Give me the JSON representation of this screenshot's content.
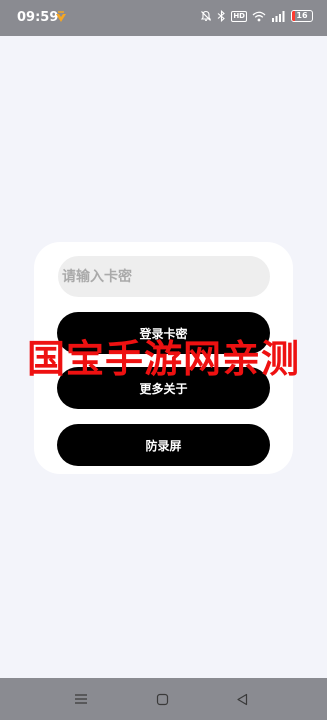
{
  "status_bar": {
    "time": "09:59",
    "battery": "16",
    "battery_level": 0.16,
    "hd_label": "HD",
    "icons": [
      "app-notification-icon",
      "mute-icon",
      "bluetooth-icon",
      "hd-icon",
      "wifi-icon",
      "signal-icon",
      "battery-icon"
    ]
  },
  "card": {
    "input_placeholder": "请输入卡密",
    "login_label": "登录卡密",
    "more_label": "更多关于",
    "screen_label": "防录屏"
  },
  "watermark": "国宝手游网亲测",
  "nav_bar": {
    "icons": [
      "menu-icon",
      "home-icon",
      "back-icon"
    ]
  },
  "colors": {
    "background": "#f3f4fa",
    "system_bars": "#8a8b91",
    "button": "#000000",
    "watermark": "#ee1111",
    "battery_low": "#ff3b30"
  }
}
